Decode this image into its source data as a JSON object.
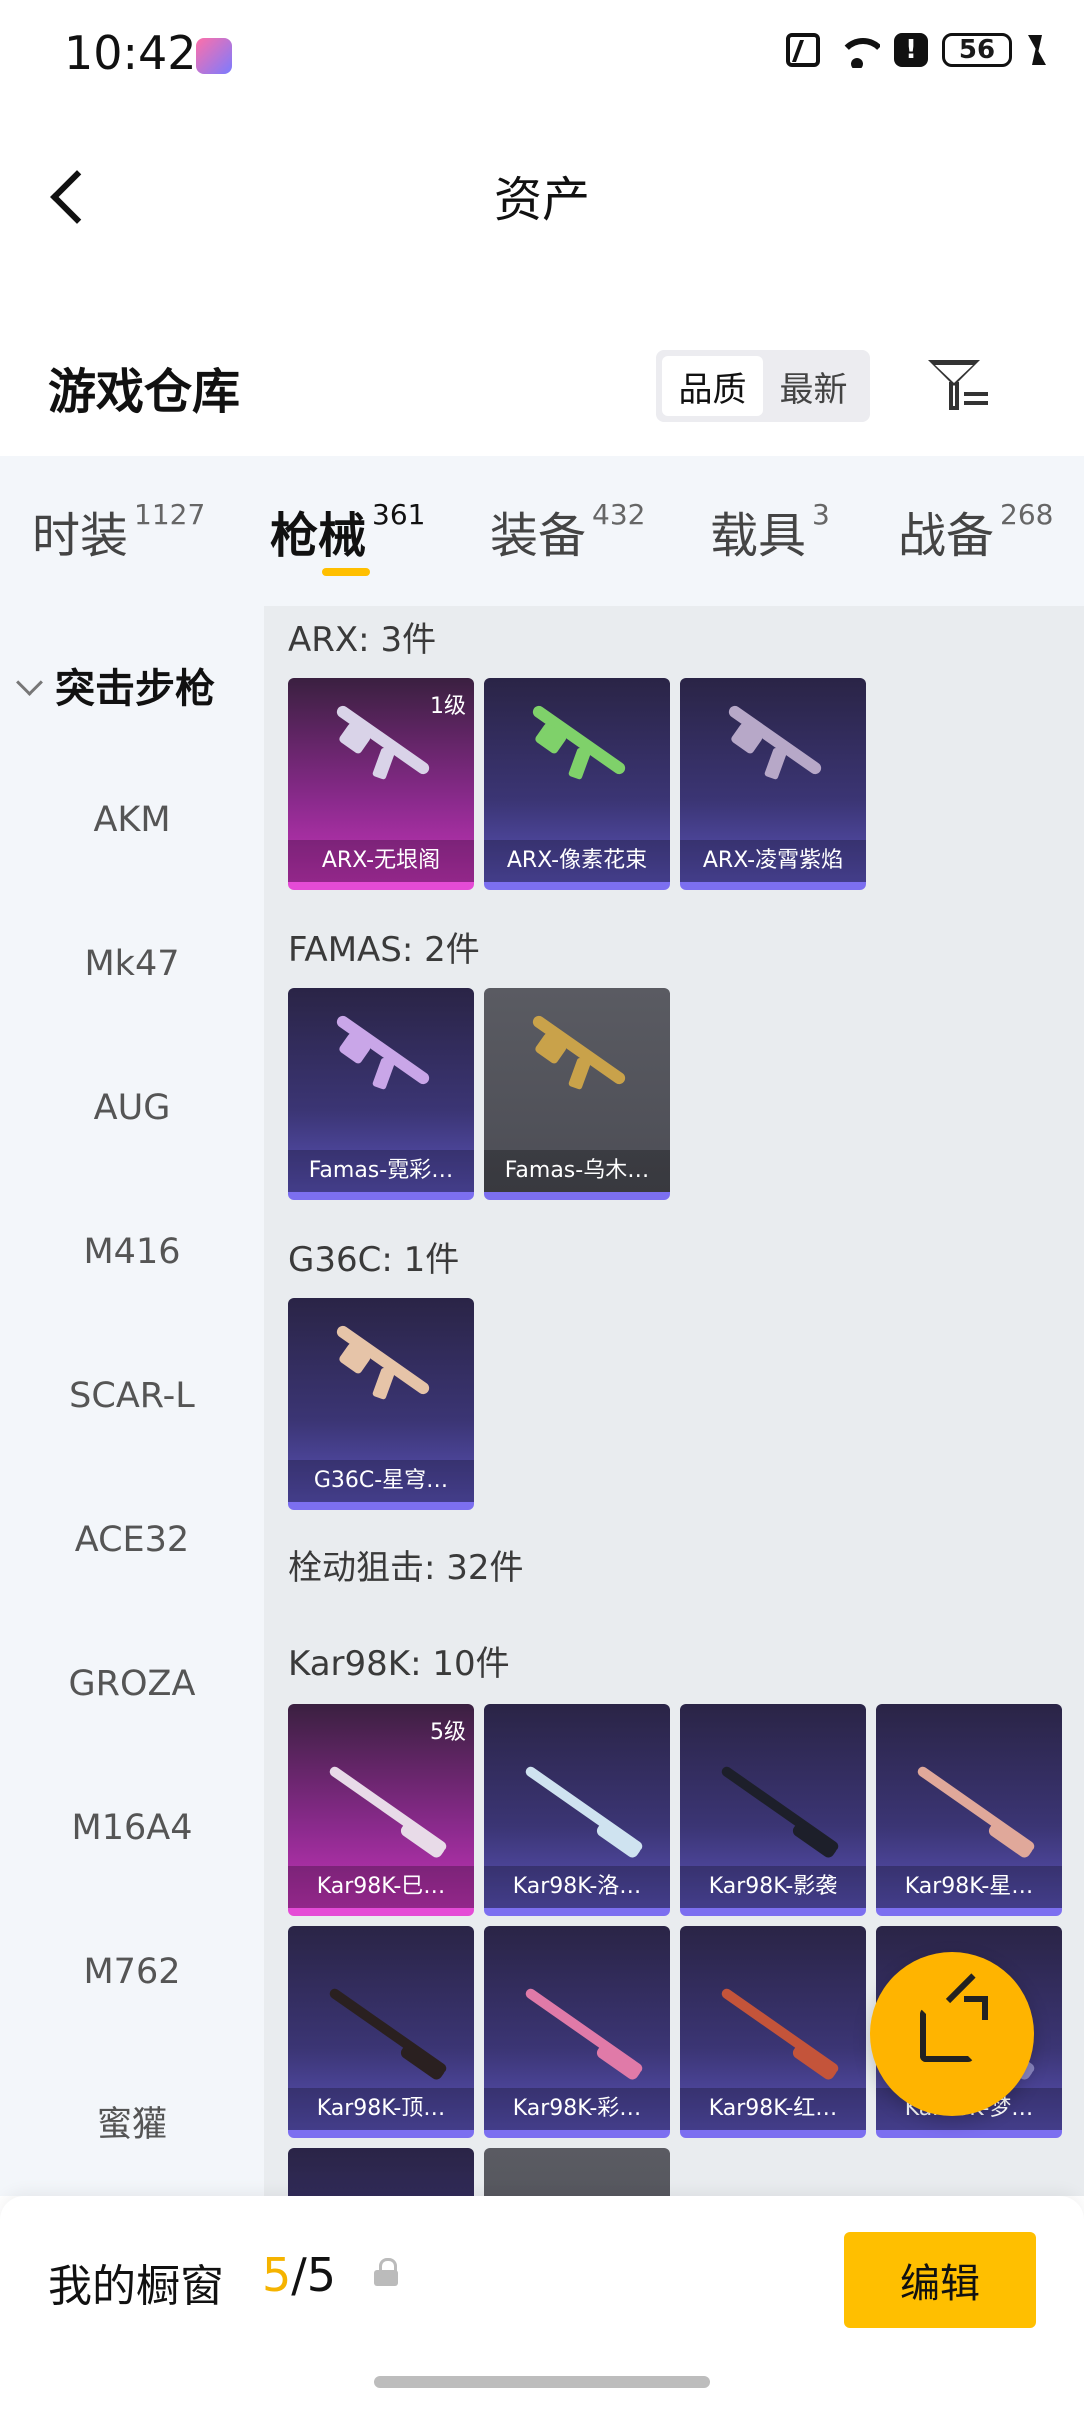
{
  "status_bar": {
    "time": "10:42",
    "battery": "56"
  },
  "header": {
    "title": "资产"
  },
  "section": {
    "title": "游戏仓库"
  },
  "sort": {
    "options": [
      "品质",
      "最新"
    ],
    "active": 0
  },
  "tabs": [
    {
      "label": "时装",
      "count": "1127"
    },
    {
      "label": "枪械",
      "count": "361"
    },
    {
      "label": "装备",
      "count": "432"
    },
    {
      "label": "载具",
      "count": "3"
    },
    {
      "label": "战备",
      "count": "268"
    }
  ],
  "sidebar": {
    "category": "突击步枪",
    "items": [
      "AKM",
      "Mk47",
      "AUG",
      "M416",
      "SCAR-L",
      "ACE32",
      "GROZA",
      "M16A4",
      "M762",
      "蜜獾"
    ]
  },
  "groups": {
    "arx": {
      "label": "ARX: 3件",
      "items": [
        {
          "name": "ARX-无垠阁",
          "level": "1级"
        },
        {
          "name": "ARX-像素花束"
        },
        {
          "name": "ARX-凌霄紫焰"
        }
      ]
    },
    "famas": {
      "label": "FAMAS: 2件",
      "items": [
        {
          "name": "Famas-霓彩…"
        },
        {
          "name": "Famas-乌木…"
        }
      ]
    },
    "g36c": {
      "label": "G36C: 1件",
      "items": [
        {
          "name": "G36C-星穹…"
        }
      ]
    },
    "sniper": {
      "label": "栓动狙击: 32件"
    },
    "kar98k": {
      "label": "Kar98K: 10件",
      "items": [
        {
          "name": "Kar98K-巳…",
          "level": "5级"
        },
        {
          "name": "Kar98K-洛…"
        },
        {
          "name": "Kar98K-影袭"
        },
        {
          "name": "Kar98K-星…"
        },
        {
          "name": "Kar98K-顶…"
        },
        {
          "name": "Kar98K-彩…"
        },
        {
          "name": "Kar98K-红…"
        },
        {
          "name": "Kar98K-梦…"
        }
      ]
    }
  },
  "showcase": {
    "label": "我的橱窗",
    "current": "5",
    "separator": "/",
    "max": "5",
    "edit_label": "编辑"
  },
  "colors": {
    "accent": "#ffbf00",
    "pink_quality": "#e54bd6",
    "purple_quality": "#7c6ff0"
  }
}
